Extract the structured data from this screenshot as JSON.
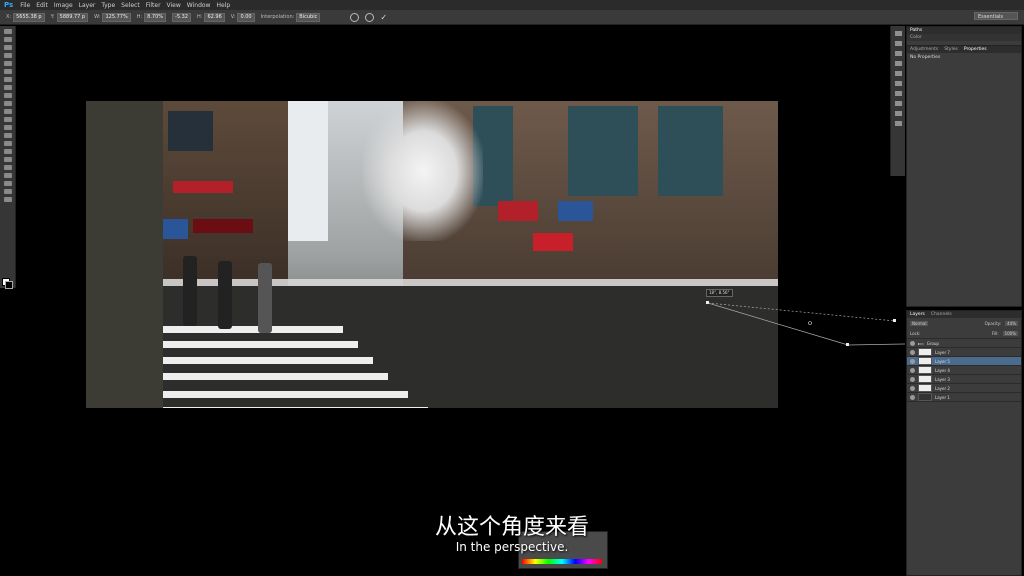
{
  "app": {
    "logo": "Ps"
  },
  "menu": [
    "File",
    "Edit",
    "Image",
    "Layer",
    "Type",
    "Select",
    "Filter",
    "View",
    "Window",
    "Help"
  ],
  "options": {
    "x_label": "X:",
    "x_value": "5655.38 p",
    "y_label": "Y:",
    "y_value": "5889.77 p",
    "w_label": "W:",
    "w_value": "125.77%",
    "h_label": "H:",
    "h_value": "8.70%",
    "rot_value": "-5.32",
    "hskew_label": "H:",
    "hskew_value": "62.96",
    "vskew_label": "V:",
    "vskew_value": "0.00",
    "interp_label": "Interpolation:",
    "interp_value": "Bicubic",
    "workspace": "Essentials"
  },
  "canvas": {
    "tooltip": "18°, 8.56°"
  },
  "panels": {
    "top": {
      "tabs": [
        "Color",
        "Swatches"
      ],
      "title": "Paths"
    },
    "properties": {
      "tabs": [
        "Adjustments",
        "Styles",
        "Properties"
      ],
      "active": "Properties",
      "body": "No Properties"
    },
    "layers": {
      "tabs": [
        "Layers",
        "Channels"
      ],
      "blend_mode": "Normal",
      "opacity_label": "Opacity:",
      "opacity_value": "44%",
      "lock_label": "Lock:",
      "fill_label": "Fill:",
      "fill_value": "100%",
      "items": [
        {
          "name": "Group"
        },
        {
          "name": "Layer 7"
        },
        {
          "name": "Layer 5"
        },
        {
          "name": "Layer 4"
        },
        {
          "name": "Layer 3"
        },
        {
          "name": "Layer 2"
        },
        {
          "name": "Layer 1"
        }
      ]
    }
  },
  "subtitles": {
    "cn": "从这个角度来看",
    "en": "In the perspective."
  }
}
